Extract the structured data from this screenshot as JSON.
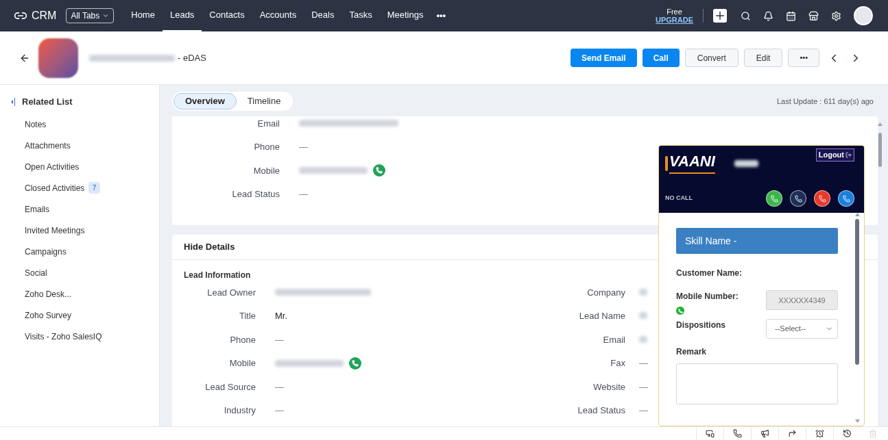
{
  "nav": {
    "brand": "CRM",
    "all_tabs": "All Tabs",
    "more": "•••",
    "plan": "Free",
    "upgrade": "UPGRADE",
    "items": [
      {
        "label": "Home",
        "selected": false
      },
      {
        "label": "Leads",
        "selected": true
      },
      {
        "label": "Contacts",
        "selected": false
      },
      {
        "label": "Accounts",
        "selected": false
      },
      {
        "label": "Deals",
        "selected": false
      },
      {
        "label": "Tasks",
        "selected": false
      },
      {
        "label": "Meetings",
        "selected": false
      }
    ]
  },
  "record": {
    "suffix": "- eDAS",
    "more": "•••",
    "actions": [
      {
        "label": "Send Email",
        "kind": "primary"
      },
      {
        "label": "Call",
        "kind": "primary"
      },
      {
        "label": "Convert",
        "kind": "secondary"
      },
      {
        "label": "Edit",
        "kind": "secondary"
      }
    ]
  },
  "sidebar": {
    "title": "Related List",
    "items": [
      {
        "label": "Notes"
      },
      {
        "label": "Attachments"
      },
      {
        "label": "Open Activities"
      },
      {
        "label": "Closed Activities",
        "count": "7"
      },
      {
        "label": "Emails"
      },
      {
        "label": "Invited Meetings"
      },
      {
        "label": "Campaigns"
      },
      {
        "label": "Social"
      },
      {
        "label": "Zoho Desk..."
      },
      {
        "label": "Zoho Survey"
      },
      {
        "label": "Visits - Zoho SalesIQ"
      }
    ]
  },
  "tabs": [
    {
      "label": "Overview",
      "selected": true
    },
    {
      "label": "Timeline",
      "selected": false
    }
  ],
  "last_update": "Last Update : 611 day(s) ago",
  "summary": [
    {
      "label": "Email",
      "kind": "redacted"
    },
    {
      "label": "Phone",
      "kind": "text",
      "value": "—"
    },
    {
      "label": "Mobile",
      "kind": "redacted_phone"
    },
    {
      "label": "Lead Status",
      "kind": "text",
      "value": "—"
    }
  ],
  "details": {
    "toggle": "Hide Details",
    "section": "Lead Information",
    "left": [
      {
        "label": "Lead Owner",
        "kind": "redacted"
      },
      {
        "label": "Title",
        "kind": "strong",
        "value": "Mr."
      },
      {
        "label": "Phone",
        "kind": "text",
        "value": "—"
      },
      {
        "label": "Mobile",
        "kind": "redacted_phone"
      },
      {
        "label": "Lead Source",
        "kind": "text",
        "value": "—"
      },
      {
        "label": "Industry",
        "kind": "text",
        "value": "—"
      }
    ],
    "right": [
      {
        "label": "Company",
        "kind": "redacted"
      },
      {
        "label": "Lead Name",
        "kind": "redacted"
      },
      {
        "label": "Email",
        "kind": "redacted"
      },
      {
        "label": "Fax",
        "kind": "text",
        "value": "—"
      },
      {
        "label": "Website",
        "kind": "text",
        "value": "—"
      },
      {
        "label": "Lead Status",
        "kind": "text",
        "value": "—"
      }
    ]
  },
  "vaani": {
    "logo": "VAANI",
    "logout": "Logout",
    "status": "NO CALL",
    "skill": "Skill Name -",
    "customer_label": "Customer Name:",
    "mobile_label": "Mobile Number:",
    "mobile_value": "XXXXXX4349",
    "dispositions_label": "Dispositions",
    "select": "--Select--",
    "remark_label": "Remark"
  }
}
